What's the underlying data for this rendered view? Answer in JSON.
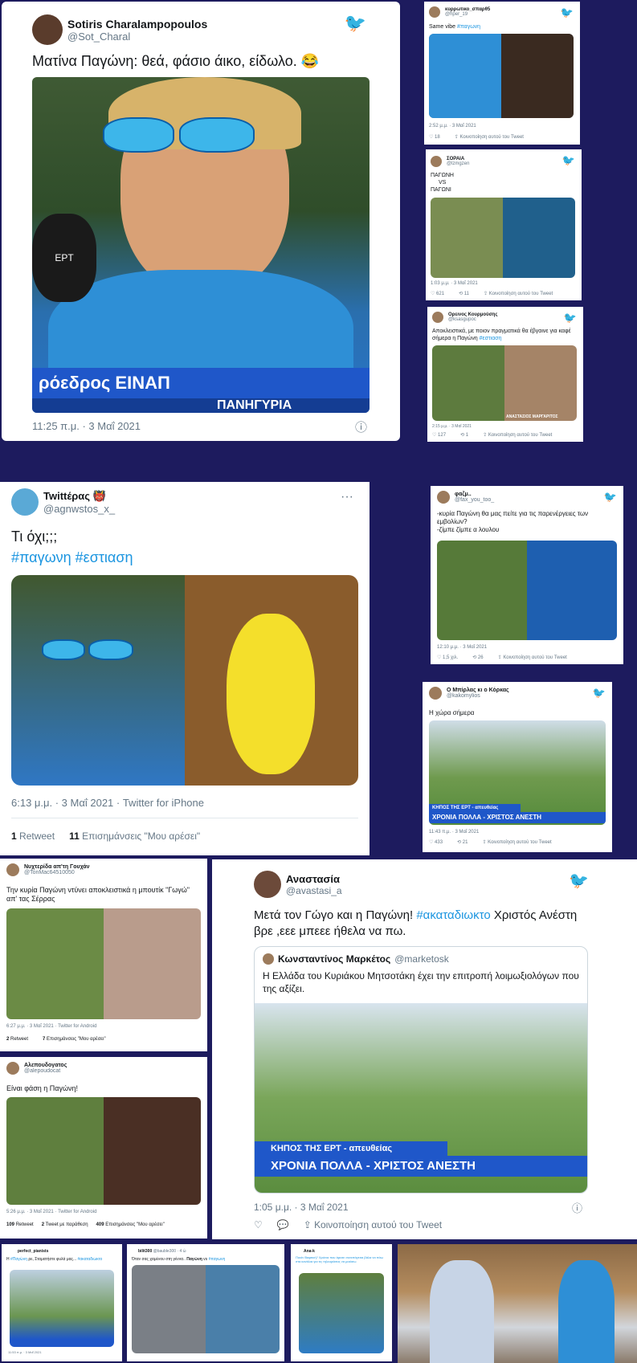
{
  "t1": {
    "name": "Sotiris Charalampopoulos",
    "handle": "@Sot_Charal",
    "text": "Ματίνα Παγώνη: θεά, φάσιο άικο, είδωλο. 😂",
    "ticker": "ρόεδρος ΕΙΝΑΠ",
    "ticker2": "ΠΑΝΗΓΥΡΙΑ",
    "mic": "ΕΡΤ",
    "time": "11:25 π.μ. · 3 Μαΐ 2021"
  },
  "t2": {
    "name": "κυρρωτικο_σπαρθ5",
    "handle": "@hper_19",
    "text": "Same vibe",
    "tag": "#παγωνη",
    "time": "2:52 μ.μ. · 3 Μαΐ 2021",
    "likes": "18",
    "share": "Κοινοποίηση αυτού του Tweet"
  },
  "t3": {
    "name": "ΣΟΡΑΙΑ",
    "handle": "@lzmgzen",
    "l1": "ΠΑΓΩΝΗ",
    "l2": "VS",
    "l3": "ΠΑΓΩΝΙ",
    "time": "1:03 μ.μ. · 3 Μαΐ 2021",
    "likes": "621",
    "rts": "11",
    "share": "Κοινοποίηση αυτού του Tweet"
  },
  "t4": {
    "name": "Ορεινος Κουρμούσης",
    "handle": "@ksasgupoc",
    "text": "Αποκλειστικά, με ποιον πραγματικά θα έβγαινε για καφέ σήμερα η Παγώνη",
    "tag": "#εστιαση",
    "caption": "ΑΝΑΣΤΑΣΙΟΣ ΜΑΡΓΑΡΙΤΟΣ",
    "time": "2:15 μ.μ. · 3 Μαΐ 2021",
    "likes": "127",
    "rts": "1",
    "share": "Κοινοποίηση αυτού του Tweet"
  },
  "t5": {
    "name": "Twittέρας 👹",
    "handle": "@agnwstos_x_",
    "text": "Τι όχι;;;",
    "tag1": "#παγωνη",
    "tag2": "#εστιαση",
    "time": "6:13 μ.μ. · 3 Μαΐ 2021 · Twitter for iPhone",
    "rt_count": "1",
    "rt_label": "Retweet",
    "like_count": "11",
    "like_label": "Επισημάνσεις \"Μου αρέσει\"",
    "more": "···"
  },
  "t6": {
    "name": "φαζμ..",
    "handle": "@fax_you_too_",
    "l1": "-κυρία Παγώνη θα μας πείτε για τις παρενέργειες των εμβολίων?",
    "l2": "-ζίμπε ζίμπε α λουλου",
    "time": "12:10 μ.μ. · 3 Μαΐ 2021",
    "likes": "1,5 χιλ.",
    "rts": "26",
    "share": "Κοινοποίηση αυτού του Tweet"
  },
  "t7": {
    "name": "Ο Μπίρλας κι ο Κόρκας",
    "handle": "@kakomylios",
    "text": "Η χώρα σήμερα",
    "banner1": "ΚΗΠΟΣ ΤΗΣ ΕΡΤ - απευθείας",
    "banner2": "ΧΡΟΝΙΑ ΠΟΛΛΑ - ΧΡΙΣΤΟΣ ΑΝΕΣΤΗ",
    "time": "11:43 π.μ. · 3 Μαΐ 2021",
    "likes": "433",
    "rts": "21",
    "share": "Κοινοποίηση αυτού του Tweet"
  },
  "t8": {
    "name": "Νυχτερίδα απ'τη Γουχάν",
    "handle": "@TonMac64510050",
    "text": "Την κυρία Παγώνη ντύνει αποκλειστικά η μπουτίκ \"Γωγώ\" απ' τας Σέρρας",
    "time": "6:27 μ.μ. · 3 Μαΐ 2021 · Twitter for Android",
    "rt_count": "2",
    "rt_label": "Retweet",
    "like_count": "7",
    "like_label": "Επισημάνσεις \"Μου αρέσει\""
  },
  "t9": {
    "name": "Αλεπουδογατος",
    "handle": "@alepoudocat",
    "text": "Είναι φάση η Παγώνη!",
    "time": "5:26 μ.μ. · 3 Μαΐ 2021 · Twitter for Android",
    "rt_count": "109",
    "rt_label": "Retweet",
    "q_count": "2",
    "q_label": "Tweet με παράθεση",
    "like_count": "409",
    "like_label": "Επισημάνσεις \"Μου αρέσει\""
  },
  "t10": {
    "name": "Αναστασία",
    "handle": "@avastasi_a",
    "text1": "Μετά τον Γώγο και η Παγώνη!",
    "tag": "#ακαταδιωκτο",
    "text2": "Χριστός Ανέστη βρε ,εεε μπεεε ήθελα να πω.",
    "q_name": "Κωνσταντίνος Μαρκέτος",
    "q_handle": "@marketosk",
    "q_text": "Η Ελλάδα του Κυριάκου Μητσοτάκη έχει την επιτροπή λοιμωξιολόγων που της αξίζει.",
    "banner1": "ΚΗΠΟΣ ΤΗΣ ΕΡΤ - απευθείας",
    "banner2": "ΧΡΟΝΙΑ ΠΟΛΛΑ - ΧΡΙΣΤΟΣ ΑΝΕΣΤΗ",
    "time": "1:05 μ.μ. · 3 Μαΐ 2021",
    "share": "Κοινοποίηση αυτού του Tweet"
  },
  "b1": {
    "name": "perfect_pianists",
    "text": "Η",
    "tag": "#Παγώνη",
    "text2": "ρε, Σταματήστε φυλά μας...",
    "tag2": "#ακαταδιωκτο",
    "time": "11:53 π.μ. · 3 Μαΐ 2021"
  },
  "b2": {
    "name": "bilit300",
    "handle": "@bauble300 · 4 ώ",
    "text": "Όταν σας χαμένου στη γέννα..",
    "bold": "Παγώνη",
    "text2": "vs",
    "tag": "#παγωνη"
  },
  "b3": {
    "name": "Ana-k",
    "text": "Ποιόν Βαφτική? Χρόνια που άρεσε συνεπάγεται βάλα να πάω στα κανάλια για τις τηλεοράσεις να μοιάσω"
  },
  "colors": {
    "twitter": "#1da1f2",
    "bg": "#1d1b5e",
    "ert": "#1f57c9"
  },
  "icons": [
    "twitter-bird-icon",
    "info-icon",
    "reply-icon",
    "retweet-icon",
    "like-icon",
    "share-icon",
    "more-icon"
  ]
}
